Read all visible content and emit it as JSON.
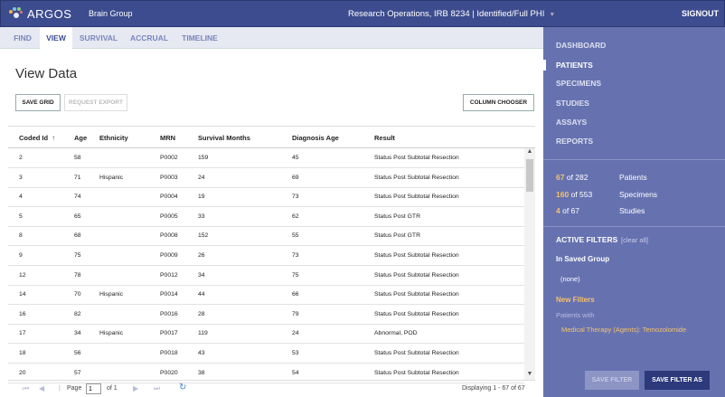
{
  "header": {
    "app_name": "ARGOS",
    "group": "Brain Group",
    "context": "Research Operations, IRB 8234 | Identified/Full PHI",
    "signout": "SIGNOUT"
  },
  "tabs": [
    "FIND",
    "VIEW",
    "SURVIVAL",
    "ACCRUAL",
    "TIMELINE"
  ],
  "active_tab": "VIEW",
  "main": {
    "title": "View Data",
    "save_grid": "SAVE GRID",
    "request_export": "REQUEST EXPORT",
    "column_chooser": "COLUMN CHOOSER"
  },
  "grid": {
    "columns": [
      "Coded Id",
      "Age",
      "Ethnicity",
      "MRN",
      "Survival Months",
      "Diagnosis Age",
      "Result"
    ],
    "sort_indicator": "↑",
    "rows": [
      [
        "2",
        "58",
        "",
        "P0002",
        "159",
        "45",
        "Status Post Subtotal Resection"
      ],
      [
        "3",
        "71",
        "Hispanic",
        "P0003",
        "24",
        "69",
        "Status Post Subtotal Resection"
      ],
      [
        "4",
        "74",
        "",
        "P0004",
        "19",
        "73",
        "Status Post Subtotal Resection"
      ],
      [
        "5",
        "65",
        "",
        "P0005",
        "33",
        "62",
        "Status Post GTR"
      ],
      [
        "8",
        "68",
        "",
        "P0008",
        "152",
        "55",
        "Status Post GTR"
      ],
      [
        "9",
        "75",
        "",
        "P0009",
        "26",
        "73",
        "Status Post Subtotal Resection"
      ],
      [
        "12",
        "78",
        "",
        "P0012",
        "34",
        "75",
        "Status Post Subtotal Resection"
      ],
      [
        "14",
        "70",
        "Hispanic",
        "P0014",
        "44",
        "66",
        "Status Post Subtotal Resection"
      ],
      [
        "16",
        "82",
        "",
        "P0016",
        "28",
        "79",
        "Status Post Subtotal Resection"
      ],
      [
        "17",
        "34",
        "Hispanic",
        "P0017",
        "119",
        "24",
        "Abnormal, POD"
      ],
      [
        "18",
        "56",
        "",
        "P0018",
        "43",
        "53",
        "Status Post Subtotal Resection"
      ],
      [
        "20",
        "57",
        "",
        "P0020",
        "38",
        "54",
        "Status Post Subtotal Resection"
      ]
    ]
  },
  "pager": {
    "page_label": "Page",
    "page_value": "1",
    "of_label": "of 1",
    "displaying": "Displaying 1 - 67 of 67"
  },
  "sidebar": {
    "nav": [
      "DASHBOARD",
      "PATIENTS",
      "SPECIMENS",
      "STUDIES",
      "ASSAYS",
      "REPORTS"
    ],
    "active_nav": "PATIENTS",
    "counts": [
      {
        "num": "67",
        "of": "of 282",
        "label": "Patients"
      },
      {
        "num": "160",
        "of": "of 553",
        "label": "Specimens"
      },
      {
        "num": "4",
        "of": "of 67",
        "label": "Studies"
      }
    ],
    "active_filters": "ACTIVE FILTERS",
    "clear_all": "[clear all]",
    "in_saved_group": "In Saved Group",
    "none": "(none)",
    "new_filters": "New Filters",
    "patients_with": "Patients with",
    "filter_item": "Medical Therapy (Agents): Temozolomide",
    "save_filter": "SAVE FILTER",
    "save_filter_as": "SAVE FILTER AS"
  },
  "colors": {
    "header_bg": "#3d4c8e",
    "sidebar_bg": "#6672b0",
    "accent_orange": "#f6c06b"
  }
}
